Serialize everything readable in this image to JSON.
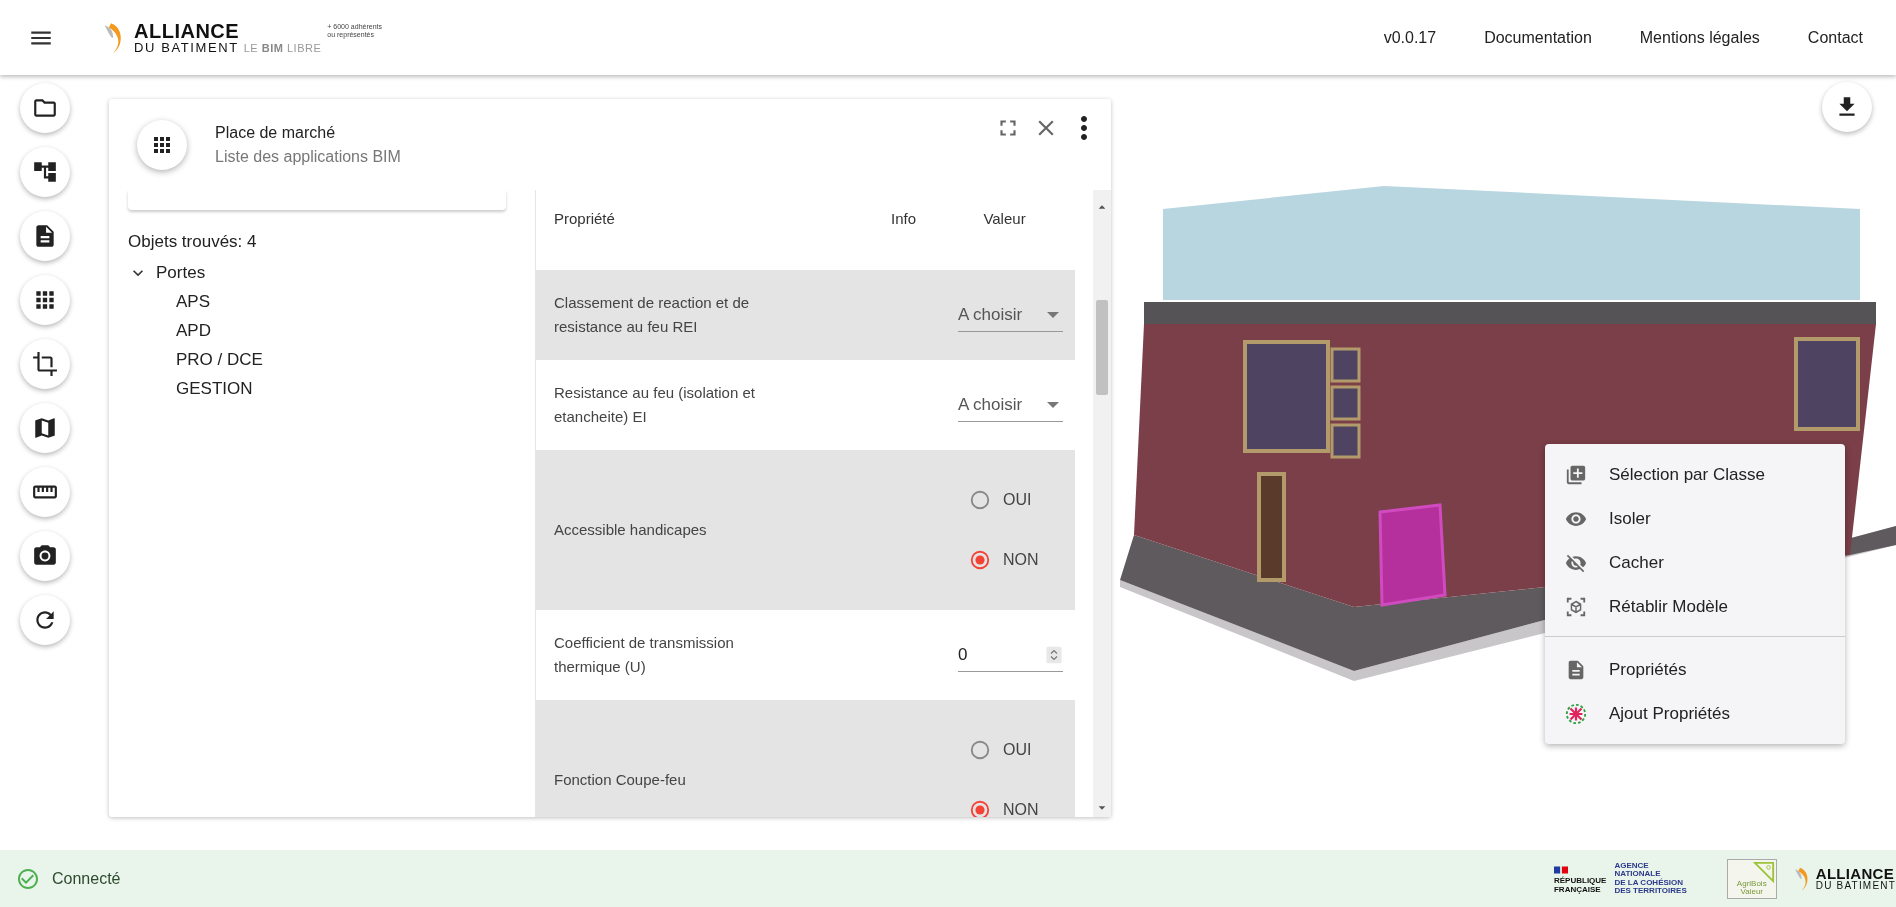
{
  "header": {
    "logo": {
      "line_1": "ALLIANCE",
      "line_2": "DU BATIMENT",
      "tagline": "LE **BIM** LIBRE",
      "members": [
        "+ 6000 adhérents",
        "ou représentés"
      ]
    },
    "nav": [
      "v0.0.17",
      "Documentation",
      "Mentions légales",
      "Contact"
    ]
  },
  "panel": {
    "title": "Place de marché",
    "subtitle": "Liste des applications BIM",
    "tree": {
      "count_label": "Objets trouvés: 4",
      "root": {
        "label": "Portes",
        "expanded": true,
        "children": [
          {
            "label": "APS"
          },
          {
            "label": "APD"
          },
          {
            "label": "PRO / DCE"
          },
          {
            "label": "GESTION"
          }
        ]
      }
    },
    "table": {
      "columns": [
        "Propriété",
        "Info",
        "Valeur"
      ],
      "rows": [
        {
          "kind": "select",
          "label": "Classement de reaction et de resistance au feu REI",
          "value": "A choisir"
        },
        {
          "kind": "select",
          "label": "Resistance au feu (isolation et etancheite) EI",
          "value": "A choisir"
        },
        {
          "kind": "radio",
          "label": "Accessible handicapes",
          "options": [
            {
              "label": "OUI",
              "selected": false
            },
            {
              "label": "NON",
              "selected": true
            }
          ]
        },
        {
          "kind": "number",
          "label": "Coefficient de transmission thermique (U)",
          "value": "0"
        },
        {
          "kind": "radio",
          "label": "Fonction Coupe-feu",
          "options": [
            {
              "label": "OUI",
              "selected": false
            },
            {
              "label": "NON",
              "selected": true
            }
          ]
        }
      ]
    }
  },
  "context_menu": {
    "groups": [
      [
        "Sélection par Classe",
        "Isoler",
        "Cacher",
        "Rétablir Modèle"
      ],
      [
        "Propriétés",
        "Ajout Propriétés"
      ]
    ]
  },
  "status_bar": {
    "status": "Connecté"
  },
  "footer_logos": {
    "republic": [
      "RÉPUBLIQUE",
      "FRANÇAISE"
    ],
    "agency": [
      "AGENCE",
      "NATIONALE",
      "DE LA COHÉSION",
      "DES TERRITOIRES"
    ],
    "agribois": [
      "AgriBois",
      "Valeur"
    ],
    "alliance": [
      "ALLIANCE",
      "DU BATIMENT"
    ]
  }
}
